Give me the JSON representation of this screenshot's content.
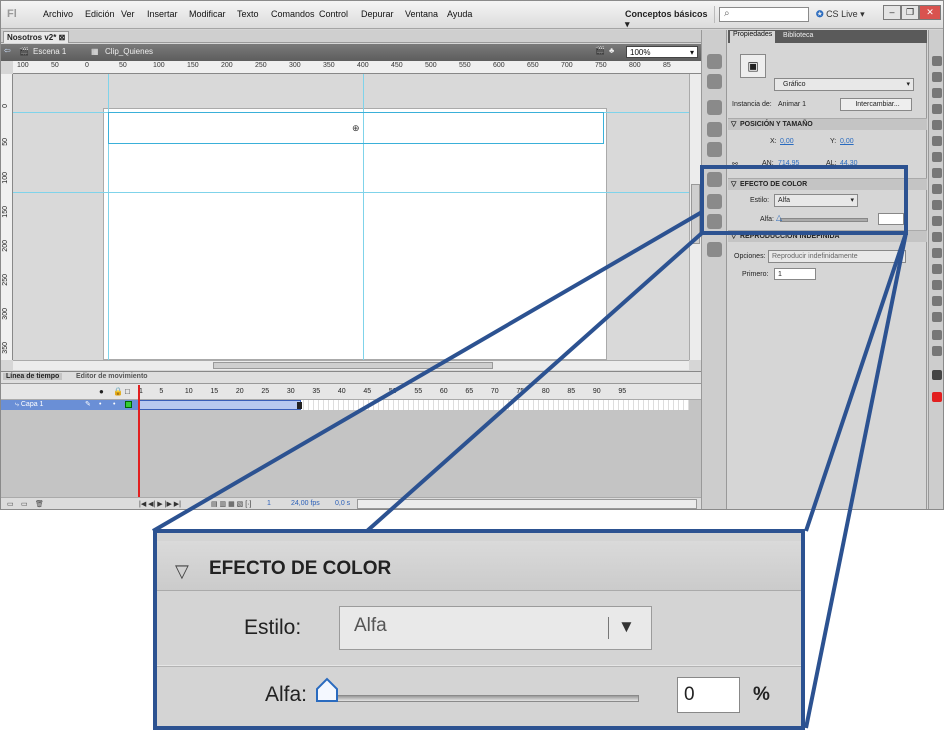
{
  "menubar": {
    "items": [
      "Archivo",
      "Edición",
      "Ver",
      "Insertar",
      "Modificar",
      "Texto",
      "Comandos",
      "Control",
      "Depurar",
      "Ventana",
      "Ayuda"
    ],
    "workspace": "Conceptos básicos",
    "cslive": "CS Live"
  },
  "document": {
    "tab": "Nosotros v2*",
    "scene": "Escena 1",
    "symbol": "Clip_Quienes",
    "zoom": "100%"
  },
  "ruler": {
    "h_ticks": [
      "100",
      "50",
      "0",
      "50",
      "100",
      "150",
      "200",
      "250",
      "300",
      "350",
      "400",
      "450",
      "500",
      "550",
      "600",
      "650",
      "700",
      "750",
      "800",
      "85"
    ],
    "v_ticks": [
      "0",
      "50",
      "100",
      "150",
      "200",
      "250",
      "300",
      "350"
    ]
  },
  "timeline": {
    "tabs": [
      "Línea de tiempo",
      "Editor de movimiento"
    ],
    "frame_numbers": [
      "1",
      "5",
      "10",
      "15",
      "20",
      "25",
      "30",
      "35",
      "40",
      "45",
      "50",
      "55",
      "60",
      "65",
      "70",
      "75",
      "80",
      "85",
      "90",
      "95"
    ],
    "layer": "Capa 1",
    "status": {
      "frame": "1",
      "fps": "24,00 fps",
      "time": "0,0 s"
    }
  },
  "properties": {
    "tabs": [
      "Propiedades",
      "Biblioteca"
    ],
    "type": "Gráfico",
    "instance_label": "Instancia de:",
    "instance_name": "Animar 1",
    "swap_button": "Intercambiar...",
    "pos_section": "POSICIÓN Y TAMAÑO",
    "x_label": "X:",
    "x": "0,00",
    "y_label": "Y:",
    "y": "0,00",
    "w_label": "AN:",
    "w": "714,95",
    "h_label": "AL:",
    "h": "44,30",
    "color_section": "EFECTO DE COLOR",
    "style_label": "Estilo:",
    "style": "Alfa",
    "alpha_label": "Alfa:",
    "loop_section": "REPRODUCCIÓN INDEFINIDA",
    "options_label": "Opciones:",
    "options": "Reproducir indefinidamente",
    "first_label": "Primero:",
    "first": "1"
  },
  "zoom_inset": {
    "header": "EFECTO DE COLOR",
    "style_label": "Estilo:",
    "style_value": "Alfa",
    "alpha_label": "Alfa:",
    "alpha_value": "0",
    "percent": "%",
    "alpha_fraction": 0
  },
  "colors": {
    "highlight_border": "#2c5291",
    "playhead": "#e21f1f",
    "layer_selected": "#6a8fd6"
  }
}
